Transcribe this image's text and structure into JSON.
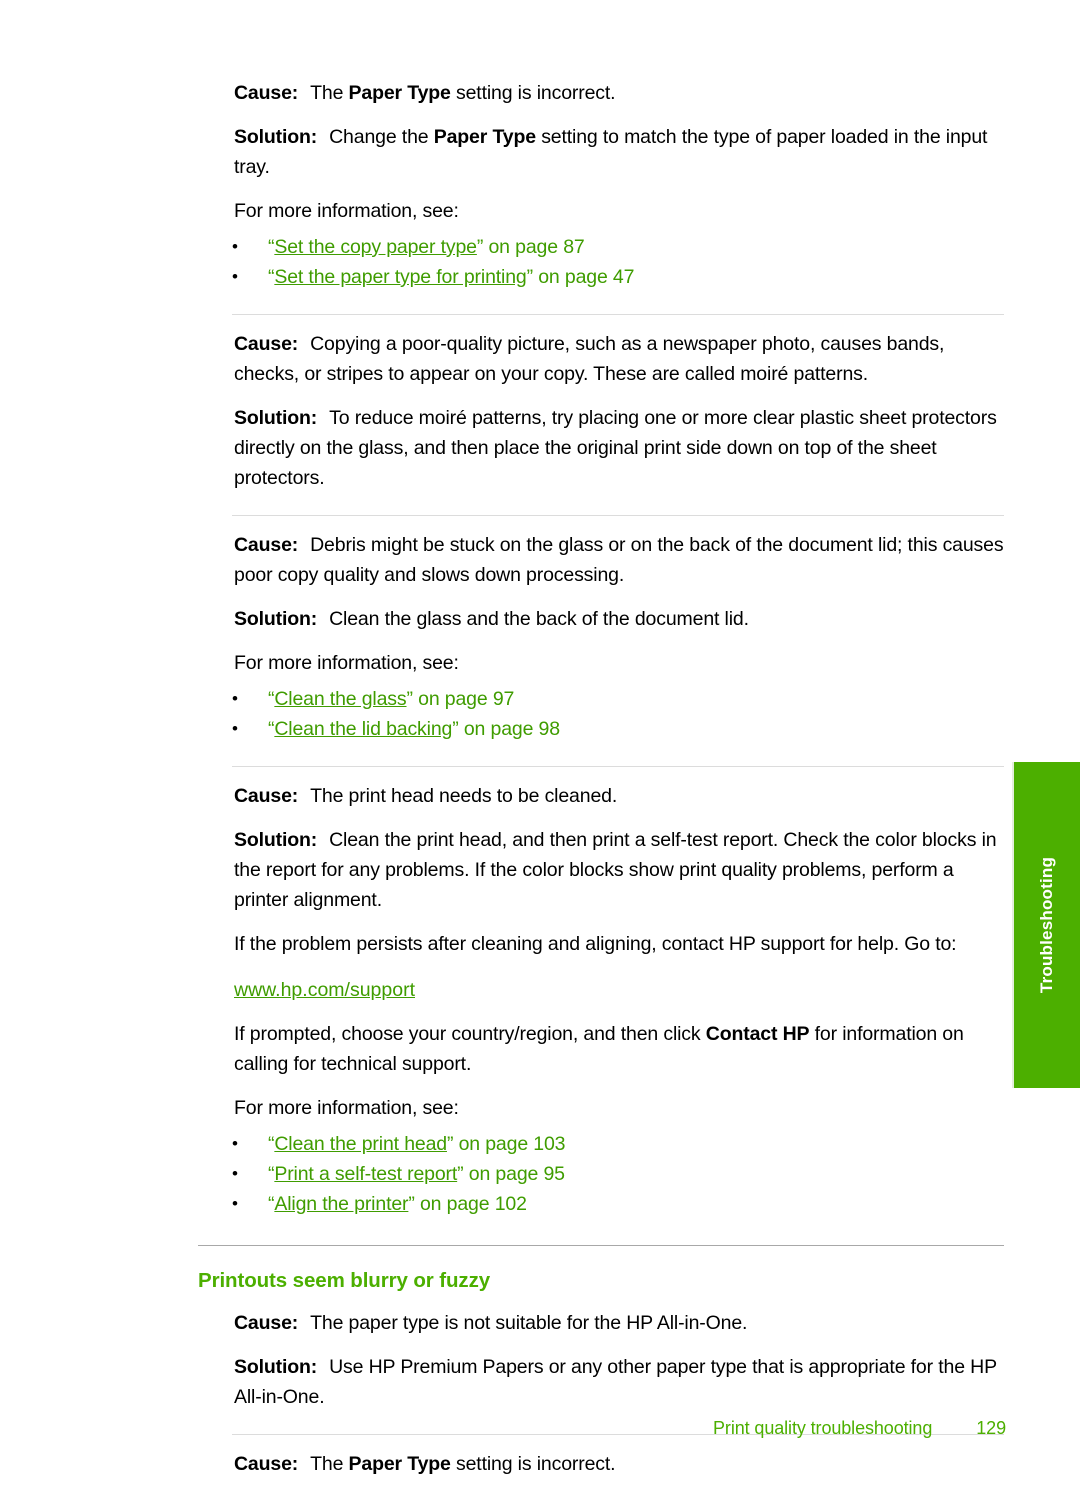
{
  "document": {
    "labels": {
      "cause": "Cause:",
      "solution": "Solution:",
      "more_info": "For more information, see:"
    },
    "colors": {
      "link_green": "#3f9c00",
      "heading_green": "#4caf00",
      "tab_green": "#4caf00",
      "divider_light": "#dcdcdc",
      "divider_section": "#a8a8a8"
    }
  },
  "blocks": {
    "b1": {
      "cause_text_1": "The ",
      "cause_bold": "Paper Type",
      "cause_text_2": " setting is incorrect.",
      "solution_text_1": "Change the ",
      "solution_bold": "Paper Type",
      "solution_text_2": " setting to match the type of paper loaded in the input tray.",
      "more_info": "For more information, see:",
      "links": [
        {
          "open_quote": "“",
          "title": "Set the copy paper type",
          "close_quote": "”",
          "tail": " on page 87"
        },
        {
          "open_quote": "“",
          "title": "Set the paper type for printing",
          "close_quote": "”",
          "tail": " on page 47"
        }
      ]
    },
    "b2": {
      "cause": "Copying a poor-quality picture, such as a newspaper photo, causes bands, checks, or stripes to appear on your copy. These are called moiré patterns.",
      "solution": "To reduce moiré patterns, try placing one or more clear plastic sheet protectors directly on the glass, and then place the original print side down on top of the sheet protectors."
    },
    "b3": {
      "cause": "Debris might be stuck on the glass or on the back of the document lid; this causes poor copy quality and slows down processing.",
      "solution": "Clean the glass and the back of the document lid.",
      "more_info": "For more information, see:",
      "links": [
        {
          "open_quote": "“",
          "title": "Clean the glass",
          "close_quote": "”",
          "tail": " on page 97"
        },
        {
          "open_quote": "“",
          "title": "Clean the lid backing",
          "close_quote": "”",
          "tail": " on page 98"
        }
      ]
    },
    "b4": {
      "cause": "The print head needs to be cleaned.",
      "solution": "Clean the print head, and then print a self-test report. Check the color blocks in the report for any problems. If the color blocks show print quality problems, perform a printer alignment.",
      "persists": "If the problem persists after cleaning and aligning, contact HP support for help. Go to:",
      "url": "www.hp.com/support",
      "prompted_text_1": "If prompted, choose your country/region, and then click ",
      "prompted_bold": "Contact HP",
      "prompted_text_2": " for information on calling for technical support.",
      "more_info": "For more information, see:",
      "links": [
        {
          "open_quote": "“",
          "title": "Clean the print head",
          "close_quote": "”",
          "tail": " on page 103"
        },
        {
          "open_quote": "“",
          "title": "Print a self-test report",
          "close_quote": "”",
          "tail": " on page 95"
        },
        {
          "open_quote": "“",
          "title": "Align the printer",
          "close_quote": "”",
          "tail": " on page 102"
        }
      ]
    },
    "b5": {
      "heading": "Printouts seem blurry or fuzzy",
      "cause": "The paper type is not suitable for the HP All-in-One.",
      "solution": "Use HP Premium Papers or any other paper type that is appropriate for the HP All-in-One."
    },
    "b6": {
      "cause_text_1": "The ",
      "cause_bold": "Paper Type",
      "cause_text_2": " setting is incorrect."
    }
  },
  "side_tab": {
    "label": "Troubleshooting"
  },
  "footer": {
    "title": "Print quality troubleshooting",
    "page_number": "129"
  }
}
